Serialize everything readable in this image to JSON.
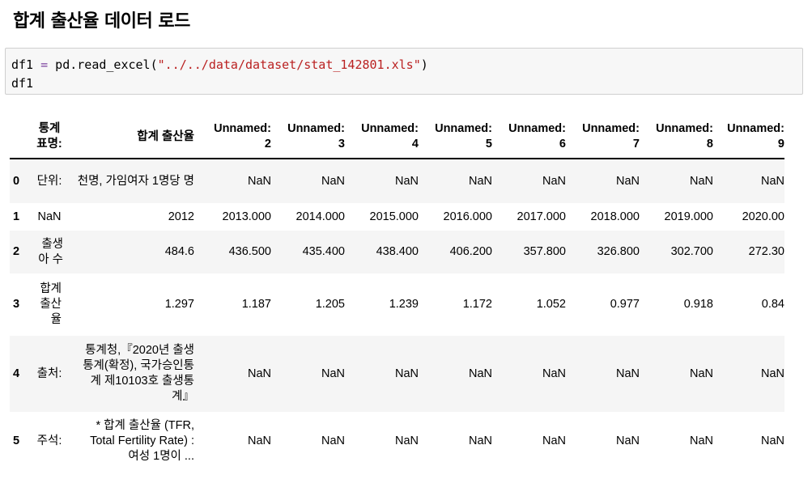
{
  "heading": "합계 출산율 데이터 로드",
  "code": {
    "line1": {
      "var": "df1 ",
      "op": "=",
      "call": " pd.read_excel(",
      "arg": "\"../../data/dataset/stat_142801.xls\"",
      "close": ")"
    },
    "line2": "df1"
  },
  "table": {
    "columns": [
      "통계 표명:",
      "합계 출산율",
      "Unnamed: 2",
      "Unnamed: 3",
      "Unnamed: 4",
      "Unnamed: 5",
      "Unnamed: 6",
      "Unnamed: 7",
      "Unnamed: 8",
      "Unnamed: 9"
    ],
    "rows": [
      {
        "index": "0",
        "cells": [
          "단위:",
          "천명, 가임여자 1명당 명",
          "NaN",
          "NaN",
          "NaN",
          "NaN",
          "NaN",
          "NaN",
          "NaN",
          "NaN"
        ]
      },
      {
        "index": "1",
        "cells": [
          "NaN",
          "2012",
          "2013.000",
          "2014.000",
          "2015.000",
          "2016.000",
          "2017.000",
          "2018.000",
          "2019.000",
          "2020.00"
        ]
      },
      {
        "index": "2",
        "cells": [
          "출생아 수",
          "484.6",
          "436.500",
          "435.400",
          "438.400",
          "406.200",
          "357.800",
          "326.800",
          "302.700",
          "272.30"
        ]
      },
      {
        "index": "3",
        "cells": [
          "합계 출산율",
          "1.297",
          "1.187",
          "1.205",
          "1.239",
          "1.172",
          "1.052",
          "0.977",
          "0.918",
          "0.84"
        ]
      },
      {
        "index": "4",
        "cells": [
          "출처:",
          "통계청,『2020년 출생통계(확정), 국가승인통계 제10103호 출생통계』",
          "NaN",
          "NaN",
          "NaN",
          "NaN",
          "NaN",
          "NaN",
          "NaN",
          "NaN"
        ]
      },
      {
        "index": "5",
        "cells": [
          "주석:",
          "* 합계 출산율 (TFR, Total Fertility Rate) : 여성 1명이 ...",
          "NaN",
          "NaN",
          "NaN",
          "NaN",
          "NaN",
          "NaN",
          "NaN",
          "NaN"
        ]
      }
    ]
  }
}
